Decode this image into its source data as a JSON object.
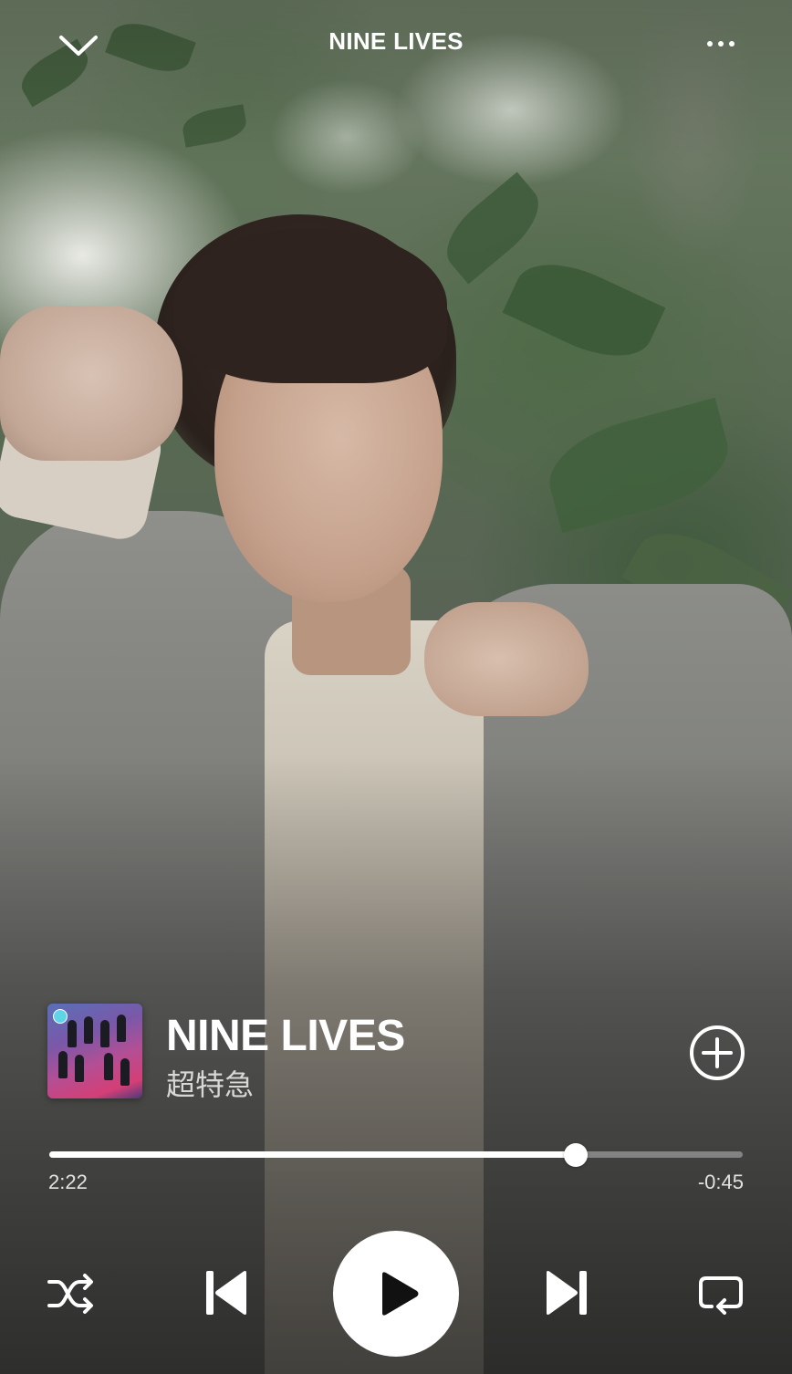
{
  "header": {
    "title": "NINE LIVES",
    "collapse_icon": "chevron-down-icon",
    "more_icon": "more-horizontal-icon"
  },
  "track": {
    "title": "NINE LIVES",
    "artist": "超特急",
    "add_icon": "plus-circle-icon"
  },
  "playback": {
    "elapsed": "2:22",
    "remaining": "-0:45",
    "progress_fraction": 0.759
  },
  "controls": {
    "shuffle_icon": "shuffle-icon",
    "previous_icon": "skip-back-icon",
    "play_icon": "play-icon",
    "next_icon": "skip-forward-icon",
    "repeat_icon": "repeat-icon"
  },
  "colors": {
    "foreground": "#ffffff",
    "progress_track": "rgba(255,255,255,0.35)",
    "play_button_bg": "#ffffff",
    "play_glyph": "#111111"
  }
}
